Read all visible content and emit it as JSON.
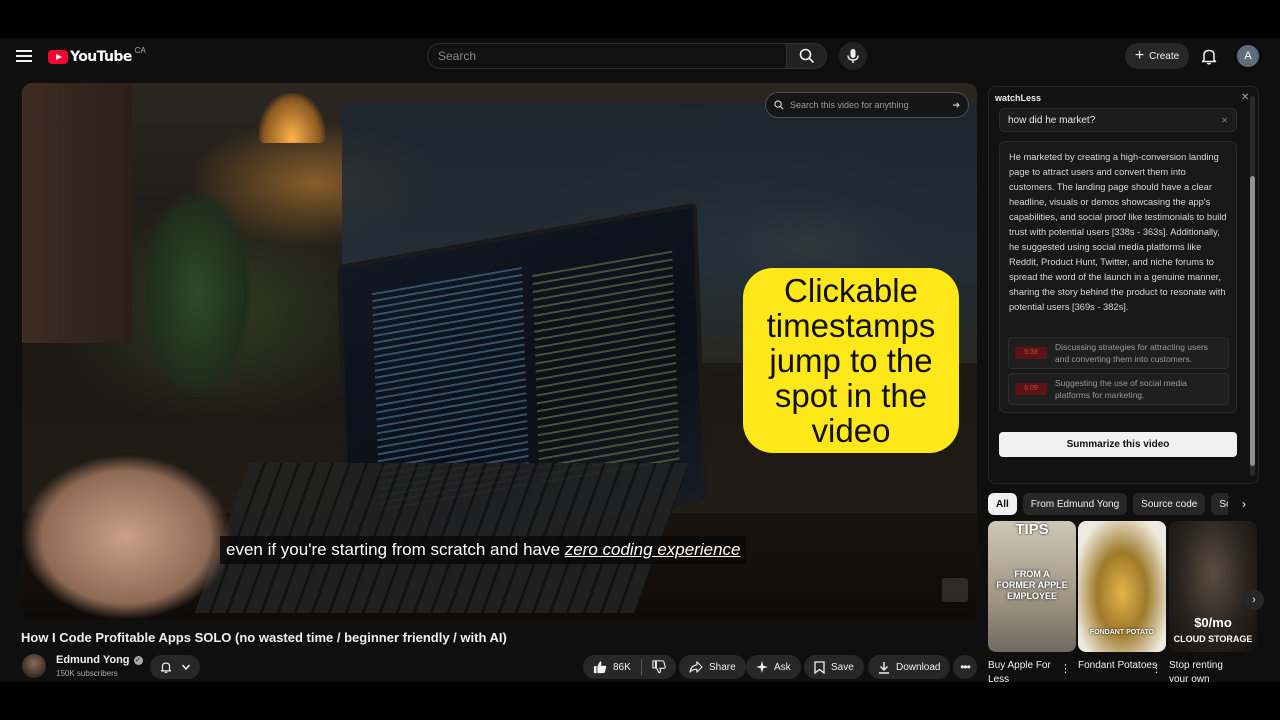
{
  "masthead": {
    "logo_text": "YouTube",
    "country": "CA",
    "search_placeholder": "Search",
    "create_label": "Create",
    "avatar_letter": "A"
  },
  "player": {
    "search_placeholder": "Search this video for anything",
    "callout": "Clickable timestamps jump to the spot in the video",
    "caption_plain": "even if you're starting from scratch and have ",
    "caption_emph": "zero coding experience"
  },
  "video": {
    "title": "How I Code Profitable Apps SOLO (no wasted time / beginner friendly / with AI)",
    "channel": "Edmund Yong",
    "subscribers": "150K subscribers",
    "likes": "86K",
    "actions": {
      "share": "Share",
      "ask": "Ask",
      "save": "Save",
      "download": "Download"
    }
  },
  "panel": {
    "title": "watchLess",
    "query": "how did he market?",
    "answer": "He marketed by creating a high-conversion landing page to attract users and convert them into customers. The landing page should have a clear headline, visuals or demos showcasing the app's capabilities, and social proof like testimonials to build trust with potential users [338s - 363s]. Additionally, he suggested using social media platforms like Reddit, Product Hunt, Twitter, and niche forums to spread the word of the launch in a genuine manner, sharing the story behind the product to resonate with potential users [369s - 382s].",
    "timestamps": [
      {
        "chip": "5:38",
        "text": "Discussing strategies for attracting users and converting them into customers."
      },
      {
        "chip": "6:09",
        "text": "Suggesting the use of social media platforms for marketing."
      }
    ],
    "summarize_label": "Summarize this video"
  },
  "chips": [
    "All",
    "From Edmund Yong",
    "Source code",
    "Sof"
  ],
  "shorts": [
    {
      "overlay_top": "TIPS",
      "overlay_text": "FROM A FORMER APPLE EMPLOYEE",
      "title": "Buy Apple For Less"
    },
    {
      "overlay_text": "FONDANT POTATO",
      "title": "Fondant Potatoes"
    },
    {
      "overlay_big": "$0/mo",
      "overlay_small": "CLOUD STORAGE",
      "title": "Stop renting your own"
    }
  ],
  "colors": {
    "accent_red": "#ff0033",
    "callout_yellow": "#ffe81a",
    "background": "#0f0f0f"
  }
}
